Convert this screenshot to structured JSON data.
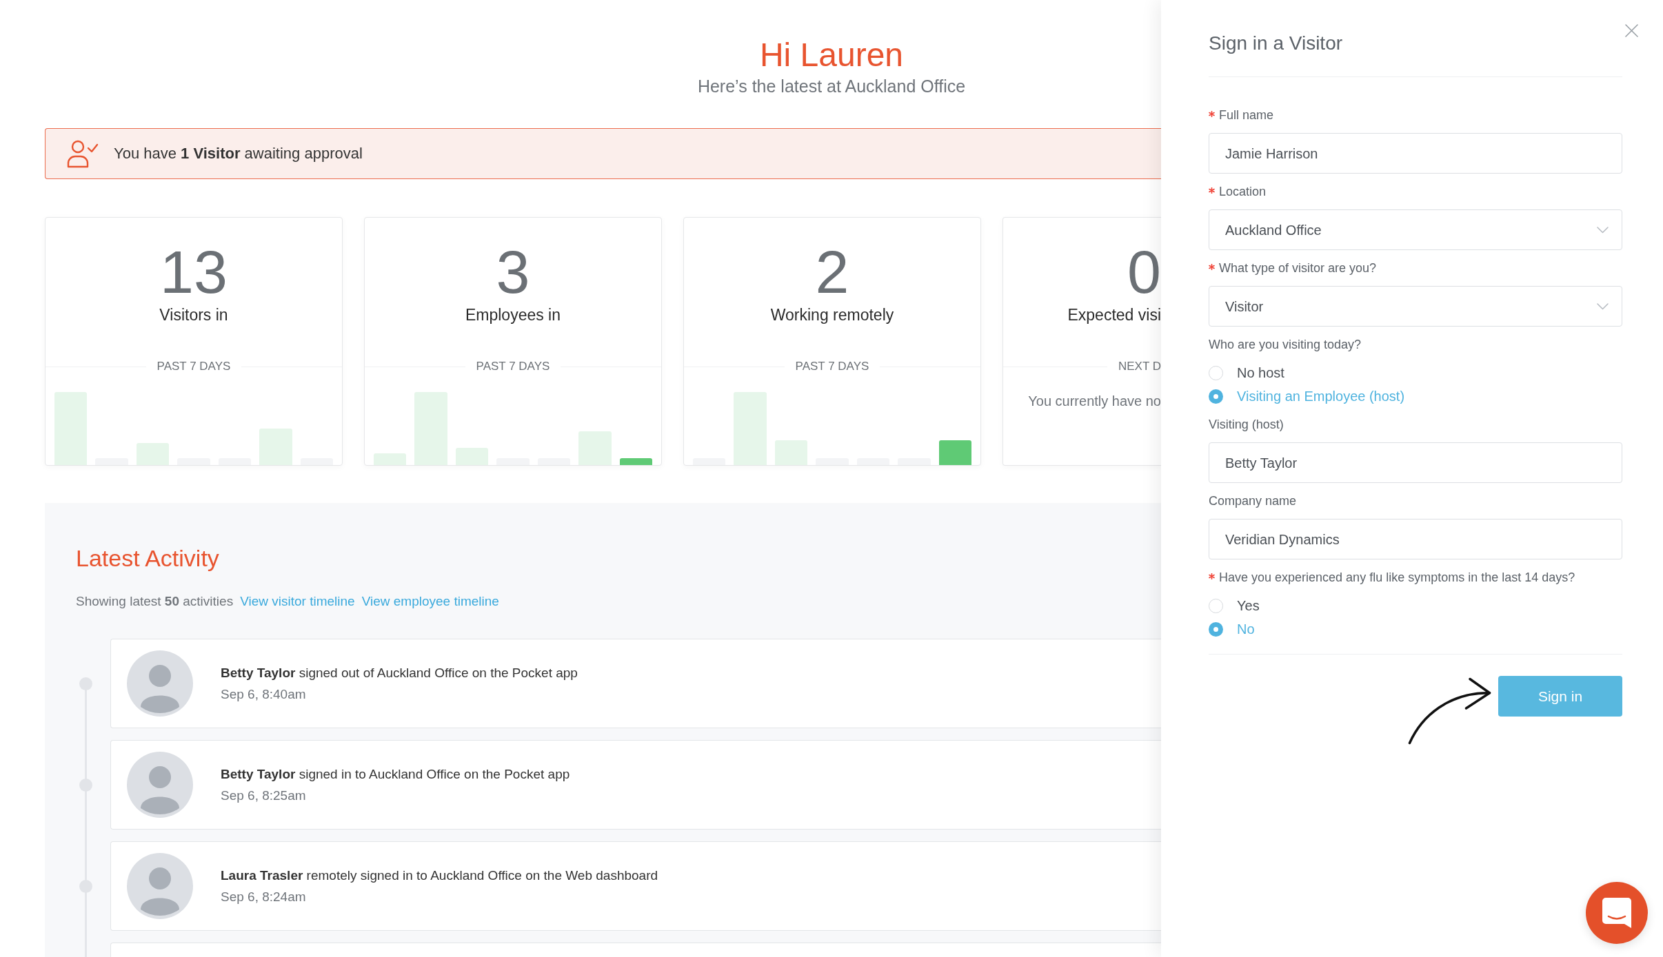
{
  "dashboard": {
    "greeting": "Hi Lauren",
    "subtitle": "Here’s the latest at Auckland Office",
    "alert": "You have **1 Visitor** awaiting approval",
    "stat_cards": [
      {
        "kind": "chart",
        "number": "13",
        "label": "Visitors in",
        "period": "PAST 7 DAYS"
      },
      {
        "kind": "chart",
        "number": "3",
        "label": "Employees in",
        "period": "PAST 7 DAYS"
      },
      {
        "kind": "chart",
        "number": "2",
        "label": "Working remotely",
        "period": "PAST 7 DAYS"
      },
      {
        "kind": "message",
        "number": "0",
        "label": "Expected visi",
        "period": "NEXT D",
        "message": "You currently have no"
      }
    ],
    "activity": {
      "title": "Latest Activity",
      "summary": "Showing latest **50** activities",
      "links": [
        "View visitor timeline",
        "View employee timeline"
      ],
      "items": [
        {
          "text": "**Betty Taylor** signed out of Auckland Office on the Pocket app",
          "time": "Sep 6, 8:40am"
        },
        {
          "text": "**Betty Taylor** signed in to Auckland Office on the Pocket app",
          "time": "Sep 6, 8:25am"
        },
        {
          "text": "**Laura Trasler** remotely signed in to Auckland Office on the Web dashboard",
          "time": "Sep 6, 8:24am"
        }
      ]
    }
  },
  "panel": {
    "title": "Sign in a Visitor",
    "fields": [
      {
        "kind": "text",
        "label": "Full name",
        "required": true,
        "value": "Jamie Harrison"
      },
      {
        "kind": "select",
        "label": "Location",
        "required": true,
        "value": "Auckland Office"
      },
      {
        "kind": "select",
        "label": "What type of visitor are you?",
        "required": true,
        "value": "Visitor"
      },
      {
        "kind": "radio",
        "label": "Who are you visiting today?",
        "required": false,
        "options": [
          {
            "label": "No host",
            "selected": false
          },
          {
            "label": "Visiting an Employee (host)",
            "selected": true
          }
        ]
      },
      {
        "kind": "text",
        "label": "Visiting (host)",
        "required": false,
        "value": "Betty Taylor"
      },
      {
        "kind": "text",
        "label": "Company name",
        "required": false,
        "value": "Veridian Dynamics"
      },
      {
        "kind": "radio",
        "label": "Have you experienced any flu like symptoms in the last 14 days?",
        "required": true,
        "options": [
          {
            "label": "Yes",
            "selected": false
          },
          {
            "label": "No",
            "selected": true
          }
        ]
      }
    ],
    "submit": "Sign in"
  }
}
